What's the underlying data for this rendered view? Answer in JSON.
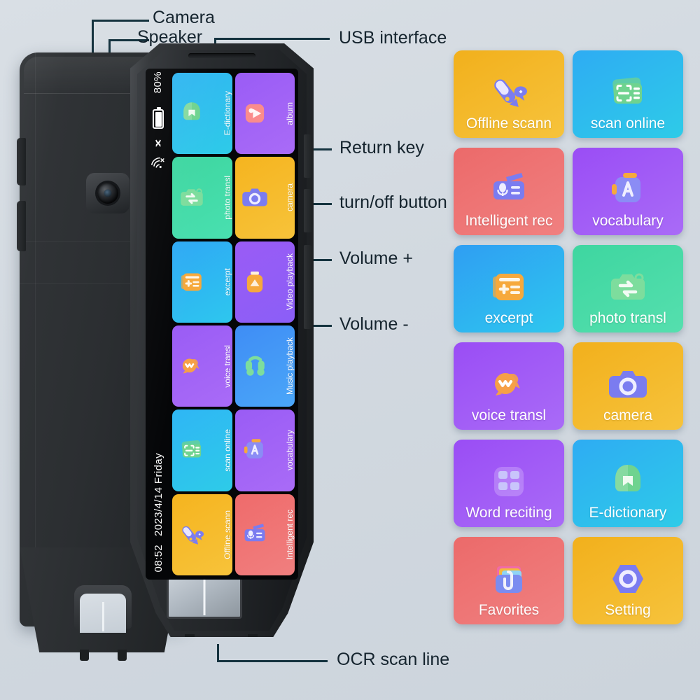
{
  "background_color": "#d3dae1",
  "callouts": [
    {
      "id": "camera",
      "label": "Camera"
    },
    {
      "id": "speaker",
      "label": "Speaker"
    },
    {
      "id": "usb",
      "label": "USB interface"
    },
    {
      "id": "return-key",
      "label": "Return key"
    },
    {
      "id": "power-button",
      "label": "turn/off button"
    },
    {
      "id": "volume-up",
      "label": "Volume +"
    },
    {
      "id": "volume-down",
      "label": "Volume -"
    },
    {
      "id": "ocr-scan-line",
      "label": "OCR scan line"
    }
  ],
  "device": {
    "status_bar": {
      "battery_percent": "80%",
      "battery_icon": "battery-icon",
      "bluetooth_icon": "bluetooth-off-icon",
      "wifi_icon": "wifi-off-icon",
      "time": "08:52",
      "date": "2023/4/14 Friday"
    },
    "screen_tiles": [
      {
        "label": "E-dictionary",
        "bg_from": "#31b5f2",
        "bg_to": "#2ecbe8",
        "icon": "dictionary-icon",
        "icon_color": "#6fd38f"
      },
      {
        "label": "album",
        "bg_from": "#9a5cf5",
        "bg_to": "#a96bf7",
        "icon": "album-icon",
        "icon_color": "#fa8c8c"
      },
      {
        "label": "photo transl",
        "bg_from": "#3ed6a0",
        "bg_to": "#49e0b0",
        "icon": "photo-translate-icon",
        "icon_color": "#7ddd9d"
      },
      {
        "label": "camera",
        "bg_from": "#f5b41f",
        "bg_to": "#f7c33a",
        "icon": "camera-icon",
        "icon_color": "#7b7cf0"
      },
      {
        "label": "excerpt",
        "bg_from": "#2fa8f5",
        "bg_to": "#2ec7ee",
        "icon": "excerpt-icon",
        "icon_color": "#f6a93c"
      },
      {
        "label": "Video playback",
        "bg_from": "#9a5cf5",
        "bg_to": "#8b5ef7",
        "icon": "video-playback-icon",
        "icon_color": "#f6a93c"
      },
      {
        "label": "voice transl",
        "bg_from": "#9a5cf5",
        "bg_to": "#a96bf7",
        "icon": "voice-translate-icon",
        "icon_color": "#f6a047"
      },
      {
        "label": "Music playback",
        "bg_from": "#3f8df5",
        "bg_to": "#4aa6f8",
        "icon": "music-playback-icon",
        "icon_color": "#7ddd9d"
      },
      {
        "label": "scan online",
        "bg_from": "#2fb6f5",
        "bg_to": "#2ecbe8",
        "icon": "scan-online-icon",
        "icon_color": "#6fd38f"
      },
      {
        "label": "vocabulary",
        "bg_from": "#9a5cf5",
        "bg_to": "#a96bf7",
        "icon": "vocabulary-icon",
        "icon_color": "#8b8cf5"
      },
      {
        "label": "Offline scann",
        "bg_from": "#f5b41f",
        "bg_to": "#f7c33a",
        "icon": "offline-scan-icon",
        "icon_color": "#7b7cf0"
      },
      {
        "label": "Intelligent rec",
        "bg_from": "#ef6b6b",
        "bg_to": "#f07f7f",
        "icon": "recorder-icon",
        "icon_color": "#7b7cf0"
      }
    ]
  },
  "app_grid": [
    {
      "label": "Offline scann",
      "bg_from": "#f2b01c",
      "bg_to": "#f6c33c",
      "icon": "offline-scan-icon",
      "icon_color": "#7b7cf0"
    },
    {
      "label": "scan online",
      "bg_from": "#2eacf3",
      "bg_to": "#2ecbe8",
      "icon": "scan-online-icon",
      "icon_color": "#6fd38f"
    },
    {
      "label": "Intelligent rec",
      "bg_from": "#ec6a6a",
      "bg_to": "#f08080",
      "icon": "recorder-icon",
      "icon_color": "#7b7cf0"
    },
    {
      "label": "vocabulary",
      "bg_from": "#9a4df5",
      "bg_to": "#a96bf7",
      "icon": "vocabulary-icon",
      "icon_color": "#8b8cf5"
    },
    {
      "label": "excerpt",
      "bg_from": "#2f9ef3",
      "bg_to": "#2ec7ee",
      "icon": "excerpt-icon",
      "icon_color": "#f6a93c"
    },
    {
      "label": "photo transl",
      "bg_from": "#3ed6a0",
      "bg_to": "#55dfae",
      "icon": "photo-translate-icon",
      "icon_color": "#7ddd9d"
    },
    {
      "label": "voice transl",
      "bg_from": "#9a4df5",
      "bg_to": "#a96bf7",
      "icon": "voice-translate-icon",
      "icon_color": "#f6a047"
    },
    {
      "label": "camera",
      "bg_from": "#f2b01c",
      "bg_to": "#f6c33c",
      "icon": "camera-icon",
      "icon_color": "#7b7cf0"
    },
    {
      "label": "Word reciting",
      "bg_from": "#9a4df5",
      "bg_to": "#a96bf7",
      "icon": "word-reciting-icon",
      "icon_color": "#c9c5fb"
    },
    {
      "label": "E-dictionary",
      "bg_from": "#2eacf3",
      "bg_to": "#2ecbe8",
      "icon": "dictionary-icon",
      "icon_color": "#6fd38f"
    },
    {
      "label": "Favorites",
      "bg_from": "#ec6a6a",
      "bg_to": "#f08080",
      "icon": "favorites-icon",
      "icon_color": "#7b8cf0"
    },
    {
      "label": "Setting",
      "bg_from": "#f2b01c",
      "bg_to": "#f6c33c",
      "icon": "setting-icon",
      "icon_color": "#7b7cf0"
    }
  ]
}
